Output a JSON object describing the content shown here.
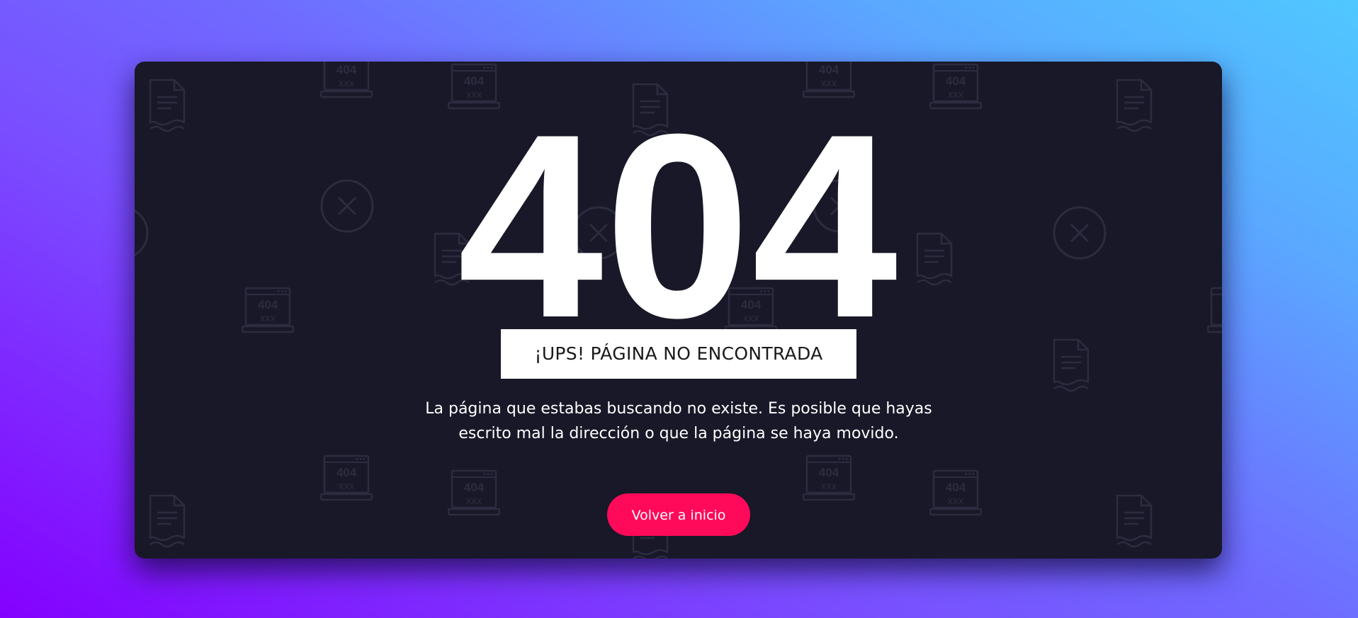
{
  "error": {
    "code": "404",
    "subtitle": "¡UPS! PÁGINA NO ENCONTRADA",
    "message": "La página que estabas buscando no existe. Es posible que hayas escrito mal la dirección o que la página se haya movido."
  },
  "actions": {
    "home_label": "Volver a inicio"
  },
  "background_icons": {
    "laptop_text": "404",
    "laptop_subtext": "xxx",
    "icon_names": [
      "laptop-404-icon",
      "document-icon",
      "close-circle-icon"
    ]
  },
  "colors": {
    "gradient_start": "#8400ff",
    "gradient_end": "#50c8ff",
    "card_bg": "#181828",
    "pattern": "#2c2c40",
    "button": "#ff0a5a",
    "text": "#ffffff"
  }
}
